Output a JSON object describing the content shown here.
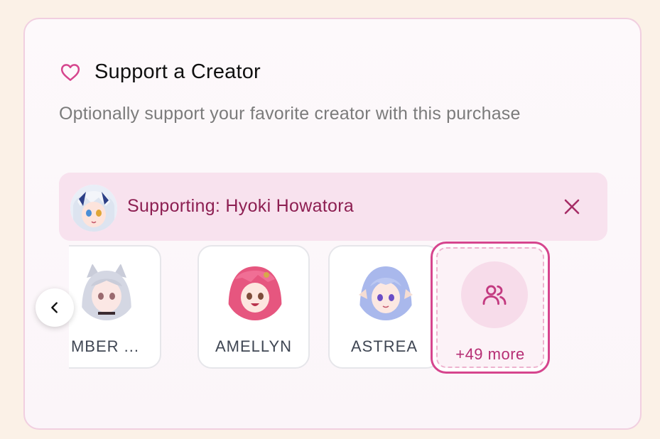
{
  "header": {
    "icon": "heart-icon",
    "title": "Support a Creator"
  },
  "subtitle": "Optionally support your favorite creator with this purchase",
  "supporting": {
    "label": "Supporting: Hyoki Howatora",
    "close_icon": "close-icon"
  },
  "creators": [
    {
      "name": "MBER ..."
    },
    {
      "name": "AMELLYN"
    },
    {
      "name": "ASTREA"
    }
  ],
  "more": {
    "label": "+49 more",
    "icon": "users-icon"
  },
  "colors": {
    "accent": "#d6458e",
    "support_bg": "#f8e2ee",
    "support_text": "#8d1f52",
    "page_bg": "#fbf1e7"
  }
}
